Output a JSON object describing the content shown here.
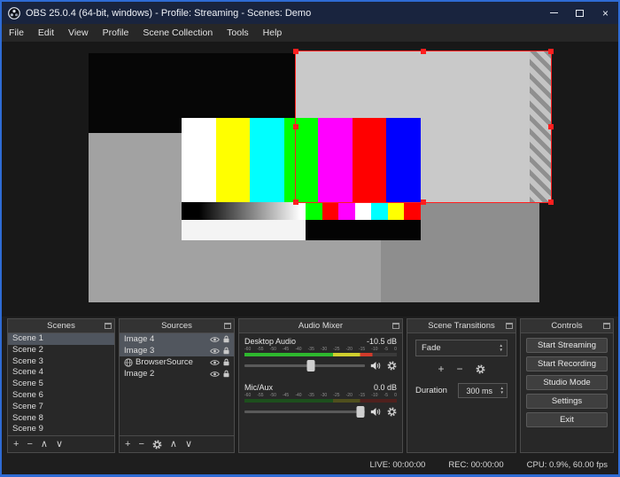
{
  "window": {
    "title": "OBS 25.0.4 (64-bit, windows) - Profile: Streaming - Scenes: Demo"
  },
  "menu": {
    "items": [
      "File",
      "Edit",
      "View",
      "Profile",
      "Scene Collection",
      "Tools",
      "Help"
    ]
  },
  "icons": {
    "plus": "+",
    "minus": "−",
    "up": "∧",
    "down": "∨",
    "close": "×",
    "combo_up": "▲",
    "combo_down": "▼"
  },
  "colors": {
    "selection_red": "#ff1f1f",
    "titlebar": "#19243e",
    "window_border": "#2e6bd4",
    "meter_green": "#2eb82e",
    "meter_yellow": "#cfcf2e",
    "meter_red": "#d23b2b"
  },
  "preview": {
    "colorbars": [
      "#ffffff",
      "#ffff00",
      "#00ffff",
      "#00ff00",
      "#ff00ff",
      "#ff0000",
      "#0000ff"
    ],
    "strip_blocks": [
      "#00ff00",
      "#ff0000",
      "#ff00ff",
      "#ffffff",
      "#00ffff",
      "#ffff00",
      "#ff0000"
    ]
  },
  "scenes": {
    "title": "Scenes",
    "items": [
      "Scene 1",
      "Scene 2",
      "Scene 3",
      "Scene 4",
      "Scene 5",
      "Scene 6",
      "Scene 7",
      "Scene 8",
      "Scene 9"
    ],
    "selected": "Scene 1"
  },
  "sources": {
    "title": "Sources",
    "items": [
      {
        "name": "Image 4",
        "selected": true
      },
      {
        "name": "Image 3",
        "selected": true
      },
      {
        "name": "BrowserSource",
        "selected": false
      },
      {
        "name": "Image 2",
        "selected": false
      }
    ]
  },
  "mixer": {
    "title": "Audio Mixer",
    "ticks": [
      "-60",
      "-55",
      "-50",
      "-45",
      "-40",
      "-35",
      "-30",
      "-25",
      "-20",
      "-15",
      "-10",
      "-5",
      "0"
    ],
    "channels": [
      {
        "name": "Desktop Audio",
        "level": "-10.5 dB",
        "slider_pct": 55,
        "active": true
      },
      {
        "name": "Mic/Aux",
        "level": "0.0 dB",
        "slider_pct": 96,
        "active": false
      }
    ]
  },
  "transitions": {
    "title": "Scene Transitions",
    "current": "Fade",
    "duration_label": "Duration",
    "duration_value": "300 ms"
  },
  "controls": {
    "title": "Controls",
    "buttons": [
      "Start Streaming",
      "Start Recording",
      "Studio Mode",
      "Settings",
      "Exit"
    ]
  },
  "statusbar": {
    "live": "LIVE: 00:00:00",
    "rec": "REC: 00:00:00",
    "cpu": "CPU: 0.9%, 60.00 fps"
  }
}
